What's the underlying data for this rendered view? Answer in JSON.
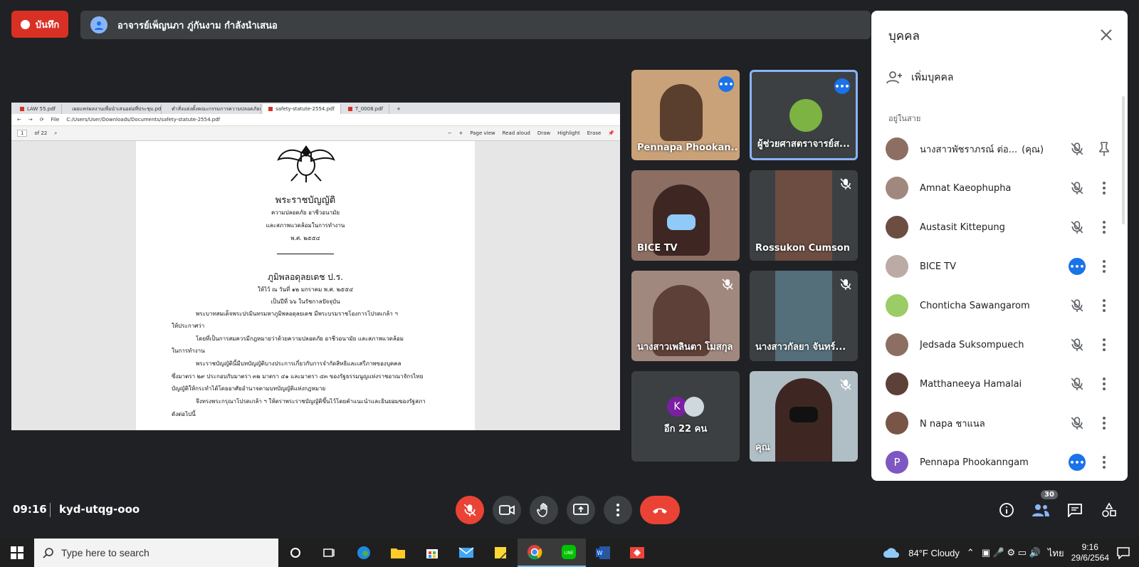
{
  "record": {
    "label": "บันทึก"
  },
  "presenting": {
    "text": "อาจารย์เพ็ญนภา ภู่กันงาม กำลังนำเสนอ"
  },
  "shared_screen": {
    "tabs": [
      "LAW 55.pdf",
      "เผยแพร่ผลงานเพื่อนำเสนอต่อที่ประชุม.pdf",
      "คำสั่งแต่งตั้งคณะกรรมการความปลอดภัยและสอน...",
      "safety-statute-2554.pdf",
      "T_0008.pdf"
    ],
    "url": "C:/Users/User/Downloads/Documents/safety-statute-2554.pdf",
    "url_prefix": "File",
    "page_num": "1",
    "page_total": "of 22",
    "toolbar": {
      "page_view": "Page view",
      "read_aloud": "Read aloud",
      "draw": "Draw",
      "highlight": "Highlight",
      "erase": "Erase"
    },
    "doc": {
      "title": "พระราชบัญญัติ",
      "sub1": "ความปลอดภัย อาชีวอนามัย",
      "sub2": "และสภาพแวดล้อมในการทำงาน",
      "year": "พ.ศ. ๒๕๕๔",
      "king": "ภูมิพลอดุลยเดช ป.ร.",
      "date": "ให้ไว้ ณ วันที่ ๑๒ มกราคม พ.ศ. ๒๕๕๔",
      "reign": "เป็นปีที่ ๖๖ ในรัชกาลปัจจุบัน",
      "p1": "พระบาทสมเด็จพระปรมินทรมหาภูมิพลอดุลยเดช มีพระบรมราชโองการโปรดเกล้า ฯ",
      "p1b": "ให้ประกาศว่า",
      "p2": "โดยที่เป็นการสมควรมีกฎหมายว่าด้วยความปลอดภัย อาชีวอนามัย และสภาพแวดล้อม",
      "p2b": "ในการทำงาน",
      "p3": "พระราชบัญญัตินี้มีบทบัญญัติบางประการเกี่ยวกับการจำกัดสิทธิและเสรีภาพของบุคคล",
      "p3b": "ซึ่งมาตรา ๒๙ ประกอบกับมาตรา ๓๒ มาตรา ๔๑ และมาตรา ๔๓ ของรัฐธรรมนูญแห่งราชอาณาจักรไทย",
      "p3c": "บัญญัติให้กระทำได้โดยอาศัยอำนาจตามบทบัญญัติแห่งกฎหมาย",
      "p4": "จึงทรงพระกรุณาโปรดเกล้า ฯ ให้ตราพระราชบัญญัติขึ้นไว้โดยคำแนะนำและยินยอมของรัฐสภา",
      "p4b": "ดังต่อไปนี้"
    }
  },
  "tiles": [
    {
      "name": "Pennapa Phookan...",
      "status": "speaking"
    },
    {
      "name": "ผู้ช่วยศาสตราจารย์ส...",
      "status": "speaking"
    },
    {
      "name": "BICE TV",
      "status": "none"
    },
    {
      "name": "Rossukon Cumson",
      "status": "muted"
    },
    {
      "name": "นางสาวเพลินตา โมสกุล",
      "status": "muted"
    },
    {
      "name": "นางสาวกัลยา จันทร์...",
      "status": "muted"
    },
    {
      "name": "อีก 22 คน",
      "avatar_letter": "K"
    },
    {
      "name": "คุณ",
      "status": "muted"
    }
  ],
  "panel": {
    "title": "บุคคล",
    "add_label": "เพิ่มบุคคล",
    "section": "อยู่ในสาย",
    "people": [
      {
        "name": "นางสาวพัชราภรณ์ ต่อ...",
        "you": "(คุณ)",
        "state": "muted",
        "action": "pin",
        "color": "#8d6e63"
      },
      {
        "name": "Amnat Kaeophupha",
        "state": "muted",
        "action": "more",
        "color": "#a1887f"
      },
      {
        "name": "Austasit Kittepung",
        "state": "muted",
        "action": "more",
        "color": "#6d4c41"
      },
      {
        "name": "BICE TV",
        "state": "speaking",
        "action": "more",
        "color": "#bcaaa4"
      },
      {
        "name": "Chonticha Sawangarom",
        "state": "muted",
        "action": "more",
        "color": "#9ccc65"
      },
      {
        "name": "Jedsada Suksompuech",
        "state": "muted",
        "action": "more",
        "color": "#8d6e63"
      },
      {
        "name": "Matthaneeya Hamalai",
        "state": "muted",
        "action": "more",
        "color": "#5d4037"
      },
      {
        "name": "N napa ชาแนล",
        "state": "muted",
        "action": "more",
        "color": "#795548"
      },
      {
        "name": "Pennapa Phookanngam",
        "state": "speaking",
        "action": "more",
        "color": "#7e57c2",
        "letter": "P"
      }
    ]
  },
  "controls": {
    "time": "09:16",
    "code": "kyd-utqg-ooo",
    "people_count": "30"
  },
  "taskbar": {
    "search_placeholder": "Type here to search",
    "weather": "84°F Cloudy",
    "lang": "ไทย",
    "clock_time": "9:16",
    "clock_date": "29/6/2564"
  },
  "colors": {
    "accent": "#1a73e8",
    "danger": "#ea4335",
    "bg": "#202124"
  }
}
